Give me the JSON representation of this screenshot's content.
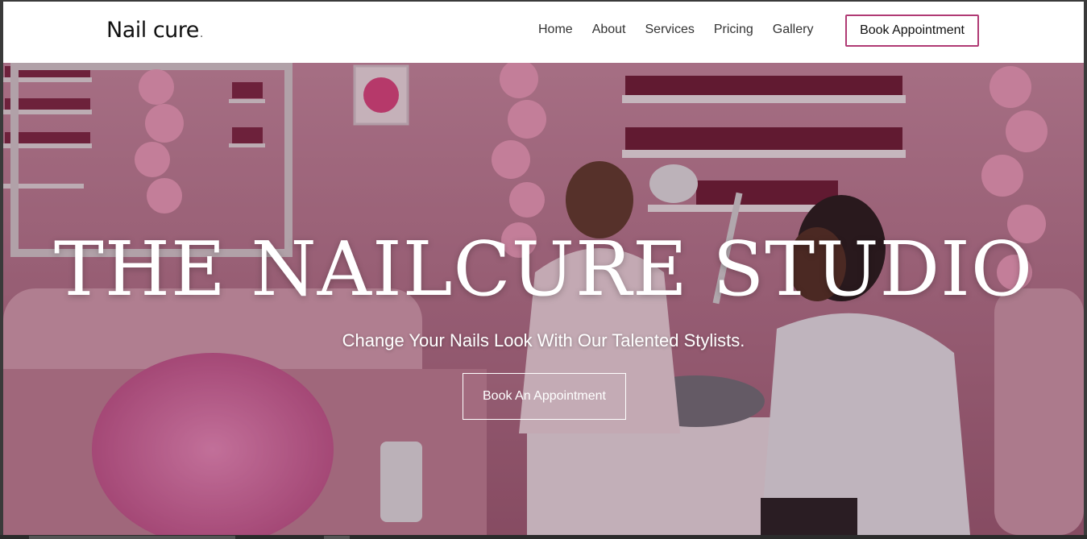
{
  "header": {
    "logo_text": "Nail cure",
    "logo_dot": ".",
    "nav": [
      "Home",
      "About",
      "Services",
      "Pricing",
      "Gallery"
    ],
    "cta_label": "Book Appointment",
    "cta_color": "#b03a74"
  },
  "hero": {
    "title": "THE NAILCURE STUDIO",
    "subtitle": "Change Your Nails Look With Our Talented Stylists.",
    "button_label": "Book An Appointment",
    "background_color": "#c9869c"
  }
}
